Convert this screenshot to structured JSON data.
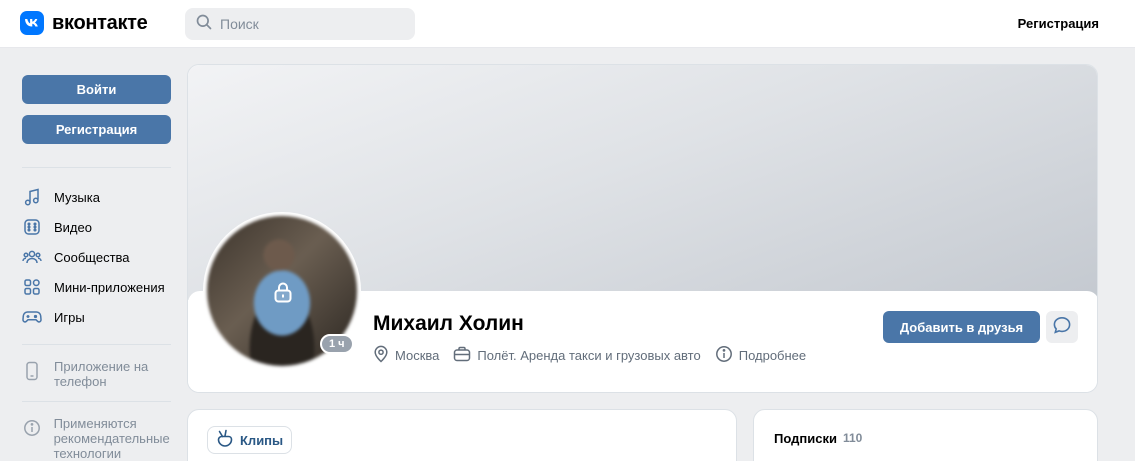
{
  "header": {
    "logo_text": "вконтакте",
    "search_placeholder": "Поиск",
    "register_label": "Регистрация"
  },
  "sidebar": {
    "login_label": "Войти",
    "register_label": "Регистрация",
    "nav": [
      {
        "label": "Музыка",
        "icon": "music-icon"
      },
      {
        "label": "Видео",
        "icon": "video-icon"
      },
      {
        "label": "Сообщества",
        "icon": "communities-icon"
      },
      {
        "label": "Мини-приложения",
        "icon": "mini-apps-icon"
      },
      {
        "label": "Игры",
        "icon": "games-icon"
      }
    ],
    "app_note": "Приложение на телефон",
    "recommend_note": "Применяются рекомендательные технологии"
  },
  "profile": {
    "name": "Михаил Холин",
    "last_seen": "1 ч",
    "city": "Москва",
    "work": "Полёт. Аренда такси и грузовых авто",
    "more_label": "Подробнее",
    "add_friend_label": "Добавить в друзья"
  },
  "clips": {
    "tab_label": "Клипы"
  },
  "subscriptions": {
    "title": "Подписки",
    "count": "110"
  },
  "colors": {
    "accent": "#4a76a8",
    "brand": "#0077ff",
    "background": "#edeef0"
  }
}
